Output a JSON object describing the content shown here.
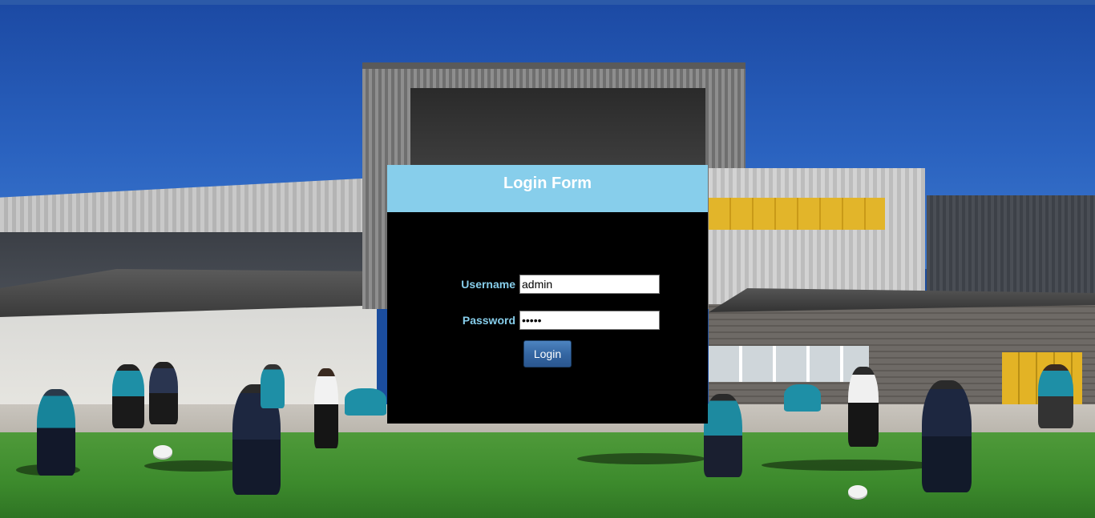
{
  "login_form": {
    "title": "Login Form",
    "username_label": "Username",
    "username_value": "admin",
    "password_label": "Password",
    "password_value": "admin",
    "login_button_label": "Login"
  },
  "colors": {
    "header_background": "#87ceeb",
    "panel_background": "#000000",
    "label_color": "#87ceeb",
    "button_background": "#3567a3"
  }
}
